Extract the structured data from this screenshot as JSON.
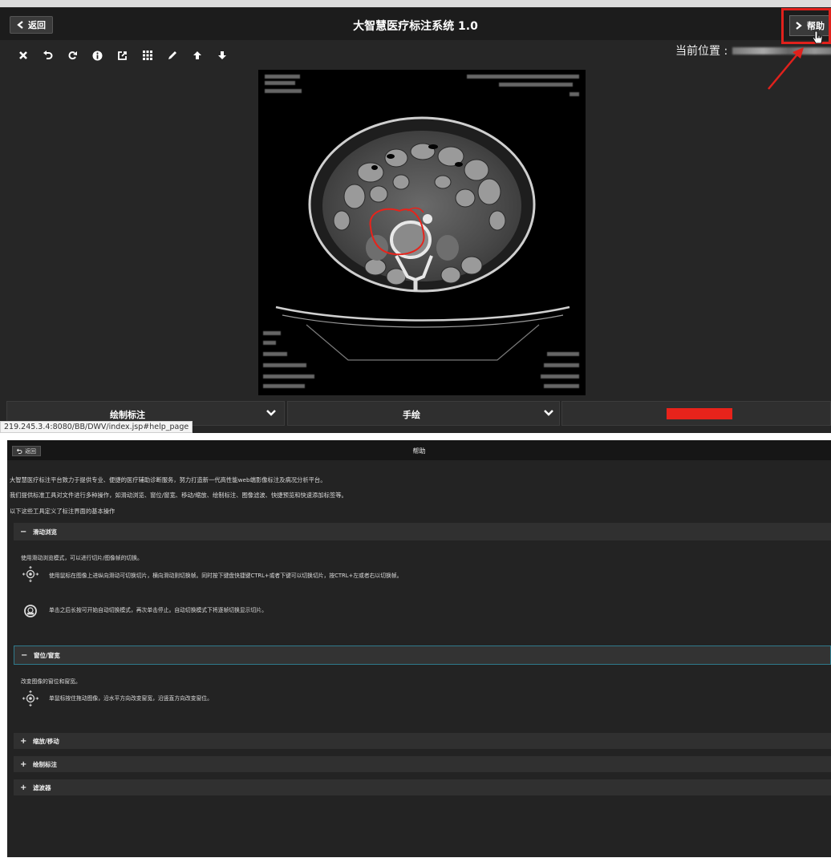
{
  "top": {
    "back_label": "返回",
    "app_title": "大智慧医疗标注系统 1.0",
    "help_label": "帮助",
    "location_label": "当前位置 :",
    "toolbar": [
      "close-icon",
      "undo-icon",
      "redo-icon",
      "info-icon",
      "export-icon",
      "grid-icon",
      "pencil-icon",
      "arrow-up-icon",
      "arrow-down-icon"
    ],
    "mode_select": "绘制标注",
    "tool_select": "手绘",
    "annotation_color": "#e8231b",
    "status_url": "219.245.3.4:8080/BB/DWV/index.jsp#help_page"
  },
  "help": {
    "back_label": "返回",
    "title": "帮助",
    "intro": [
      "大智慧医疗标注平台致力于提供专业、便捷的医疗辅助诊断服务，努力打造新一代高性能web端影像标注及病况分析平台。",
      "我们提供标准工具对文件进行多种操作，如滑动浏览、窗位/窗宽、移动/缩放、绘制标注、图像滤波、快捷预览和快速添加标签等。",
      "以下这些工具定义了标注界面的基本操作"
    ],
    "sections": [
      {
        "title": "滑动浏览",
        "expanded": true,
        "desc": "使用滑动浏览模式，可以进行切片/图像帧的切换。",
        "rows": [
          {
            "icon": "mouse-move-icon",
            "text": "使用鼠标在图像上进纵向滑动可切换切片，横向滑动则切换帧。同时按下键盘快捷键CTRL+或者下键可以切换切片，按CTRL+左或者右以切换帧。"
          },
          {
            "icon": "mouse-click-icon",
            "text": "单击之后长按可开始自动切换模式，再次单击停止。自动切换模式下将逐帧切换显示切片。"
          }
        ]
      },
      {
        "title": "窗位/窗宽",
        "expanded": true,
        "desc": "改变图像的窗位和窗宽。",
        "rows": [
          {
            "icon": "mouse-move-icon",
            "text": "单鼠标按住拖动图像，沿水平方向改变窗宽，沿竖直方向改变窗位。"
          }
        ]
      },
      {
        "title": "缩放/移动",
        "expanded": false
      },
      {
        "title": "绘制标注",
        "expanded": false
      },
      {
        "title": "滤波器",
        "expanded": false
      }
    ]
  },
  "colors": {
    "highlight": "#e0211c",
    "accent_border": "#2f7a8c"
  }
}
